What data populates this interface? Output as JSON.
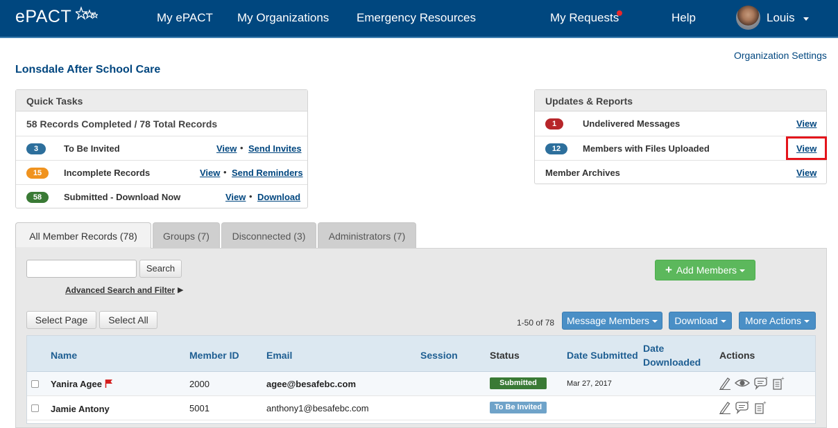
{
  "nav": {
    "logo": "ePACT",
    "items": [
      "My ePACT",
      "My Organizations",
      "Emergency Resources",
      "My Requests",
      "Help"
    ],
    "user": "Louis"
  },
  "org": {
    "settings_link": "Organization Settings",
    "name": "Lonsdale After School Care"
  },
  "quick_tasks": {
    "title": "Quick Tasks",
    "summary": "58 Records Completed / 78 Total Records",
    "rows": [
      {
        "count": "3",
        "color": "#2d6f9c",
        "label": "To Be Invited",
        "view": "View",
        "action": "Send Invites"
      },
      {
        "count": "15",
        "color": "#f0931f",
        "label": "Incomplete Records",
        "view": "View",
        "action": "Send Reminders"
      },
      {
        "count": "58",
        "color": "#3a7a35",
        "label": "Submitted - Download Now",
        "view": "View",
        "action": "Download"
      }
    ]
  },
  "updates": {
    "title": "Updates & Reports",
    "rows": [
      {
        "count": "1",
        "color": "#b7262a",
        "label": "Undelivered Messages",
        "view": "View"
      },
      {
        "count": "12",
        "color": "#2d6f9c",
        "label": "Members with Files Uploaded",
        "view": "View"
      },
      {
        "count": "",
        "label": "Member Archives",
        "view": "View"
      }
    ]
  },
  "tabs": [
    "All Member Records (78)",
    "Groups (7)",
    "Disconnected (3)",
    "Administrators (7)"
  ],
  "search": {
    "placeholder": "",
    "button": "Search",
    "advanced": "Advanced Search and Filter"
  },
  "add_members": "Add Members",
  "select_page": "Select Page",
  "select_all": "Select All",
  "pagination": "1-50 of 78",
  "actions": {
    "message": "Message Members",
    "download": "Download",
    "more": "More Actions"
  },
  "table": {
    "headers": [
      "Name",
      "Member ID",
      "Email",
      "Session",
      "Status",
      "Date Submitted",
      "Date",
      "Downloaded",
      "Actions"
    ],
    "rows": [
      {
        "name": "Yanira Agee",
        "id": "2000",
        "email": "agee@besafebc.com",
        "status": "Submitted",
        "status_color": "#3a7a35",
        "date": "Mar 27, 2017",
        "flag": true
      },
      {
        "name": "Jamie Antony",
        "id": "5001",
        "email": "anthony1@besafebc.com",
        "status": "To Be Invited",
        "status_color": "#6fa3c9",
        "date": "",
        "flag": false
      }
    ]
  }
}
